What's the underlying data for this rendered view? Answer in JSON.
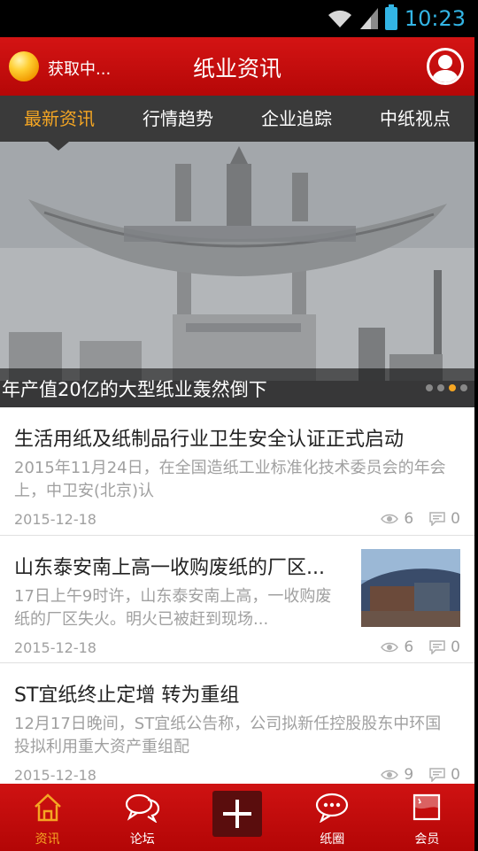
{
  "status_bar": {
    "time": "10:23"
  },
  "header": {
    "loading_text": "获取中...",
    "title": "纸业资讯"
  },
  "tabs": [
    {
      "label": "最新资讯",
      "active": true
    },
    {
      "label": "行情趋势",
      "active": false
    },
    {
      "label": "企业追踪",
      "active": false
    },
    {
      "label": "中纸视点",
      "active": false
    }
  ],
  "banner": {
    "caption": "年产值20亿的大型纸业轰然倒下",
    "slide_count": 4,
    "active_slide": 3
  },
  "news": [
    {
      "title": "生活用纸及纸制品行业卫生安全认证正式启动",
      "summary": "2015年11月24日，在全国造纸工业标准化技术委员会的年会上，中卫安(北京)认",
      "date": "2015-12-18",
      "views": "6",
      "comments": "0"
    },
    {
      "title": "山东泰安南上高一收购废纸的厂区...",
      "summary": "17日上午9时许，山东泰安南上高，一收购废纸的厂区失火。明火已被赶到现场...",
      "date": "2015-12-18",
      "views": "6",
      "comments": "0"
    },
    {
      "title": "ST宜纸终止定增 转为重组",
      "summary": "12月17日晚间，ST宜纸公告称，公司拟新任控股股东中环国投拟利用重大资产重组配",
      "date": "2015-12-18",
      "views": "9",
      "comments": "0"
    }
  ],
  "bottom_nav": [
    {
      "label": "资讯",
      "icon": "home-icon",
      "active": true
    },
    {
      "label": "论坛",
      "icon": "chat-bubbles-icon",
      "active": false
    },
    {
      "label": "",
      "icon": "plus-icon",
      "active": false
    },
    {
      "label": "纸圈",
      "icon": "speech-dots-icon",
      "active": false
    },
    {
      "label": "会员",
      "icon": "flag-card-icon",
      "active": false
    }
  ],
  "colors": {
    "header_red": "#c80c0c",
    "tab_bar": "#3a3a3a",
    "accent_orange": "#f5a623",
    "status_blue": "#33b5e5"
  }
}
